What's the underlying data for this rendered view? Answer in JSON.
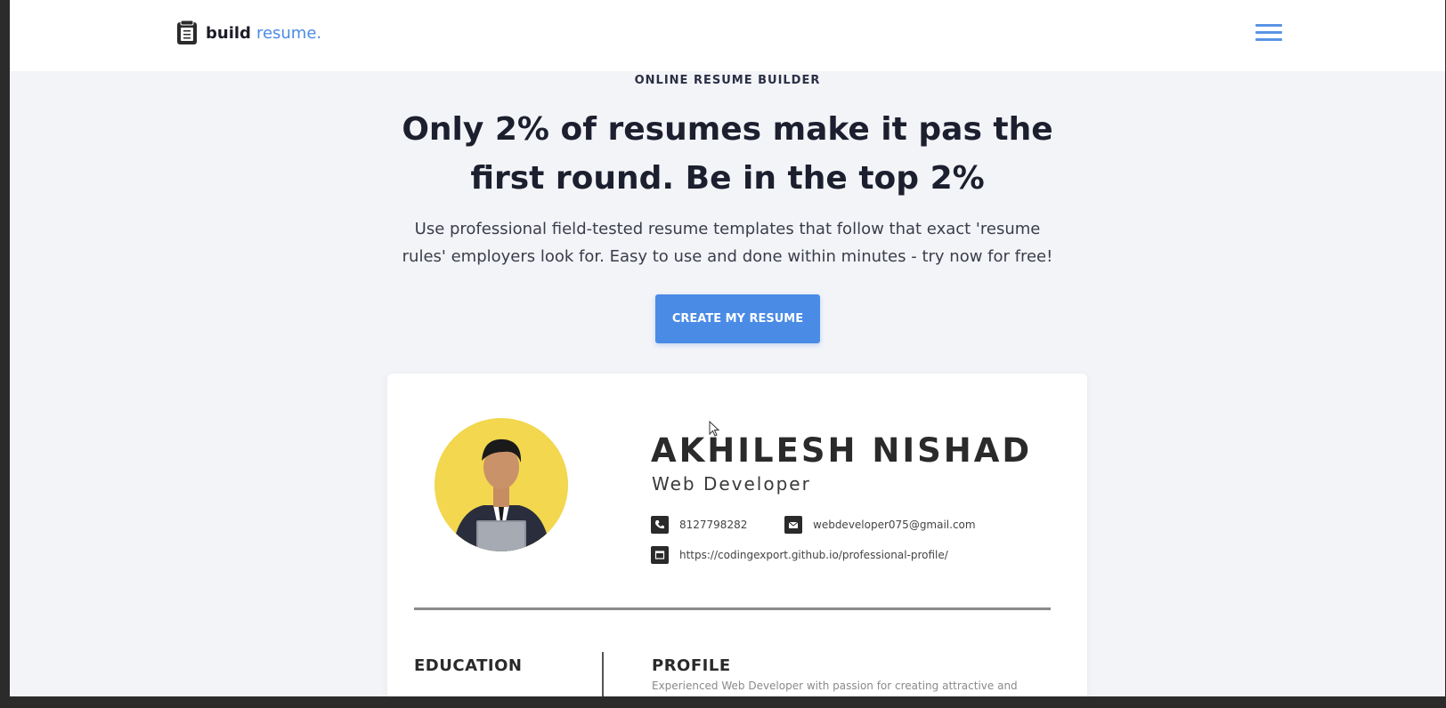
{
  "navbar": {
    "brand_primary": "build",
    "brand_accent": "resume.",
    "logo_icon": "resume-doc-icon",
    "menu_icon": "hamburger-menu-icon"
  },
  "hero": {
    "eyebrow": "ONLINE RESUME BUILDER",
    "headline_line1": "Only 2% of resumes make it pas the",
    "headline_line2": "first round. Be in the top 2%",
    "subtext_line1": "Use professional field-tested resume templates that follow that exact 'resume",
    "subtext_line2": "rules' employers look for. Easy to use and done within minutes - try now for free!",
    "cta_label": "CREATE MY RESUME"
  },
  "resume_preview": {
    "name": "AKHILESH NISHAD",
    "role": "Web Developer",
    "phone": "8127798282",
    "email": "webdeveloper075@gmail.com",
    "website": "https://codingexport.github.io/professional-profile/",
    "education_title": "EDUCATION",
    "profile_title": "PROFILE",
    "profile_text": "Experienced Web Developer with passion for creating attractive and"
  },
  "colors": {
    "accent": "#4a8be6",
    "page_bg": "#f3f4f8",
    "avatar_bg": "#f2d74f"
  }
}
